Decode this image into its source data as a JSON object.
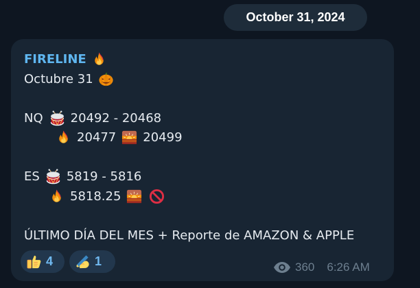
{
  "date_label": "October 31, 2024",
  "message": {
    "author": "FIRELINE",
    "author_icon": "fire-icon",
    "lines": {
      "date": "Octubre 31",
      "nq_label": "NQ",
      "nq_range": "20492 - 20468",
      "nq_fire_value": "20477",
      "nq_sunset_value": "20499",
      "es_label": "ES",
      "es_range": "5819 - 5816",
      "es_fire_value": "5818.25",
      "closing": "ÚLTIMO DÍA DEL MES + Reporte de AMAZON & APPLE"
    },
    "icons": [
      "fire-icon",
      "jack-o-lantern-icon",
      "drum-icon",
      "sunset-icon",
      "prohibited-icon"
    ]
  },
  "reactions": [
    {
      "emoji": "thumbs-up-icon",
      "count": "4"
    },
    {
      "emoji": "writing-hand-icon",
      "count": "1"
    }
  ],
  "footer": {
    "views": "360",
    "time": "6:26 AM",
    "views_icon": "eye-icon"
  },
  "colors": {
    "background": "#0e1621",
    "bubble": "#182533",
    "author": "#5fb6f0",
    "text": "#e6ebf0",
    "reaction_bg": "#22374d",
    "reaction_text": "#70b9f0",
    "meta": "#6d7f8f"
  }
}
